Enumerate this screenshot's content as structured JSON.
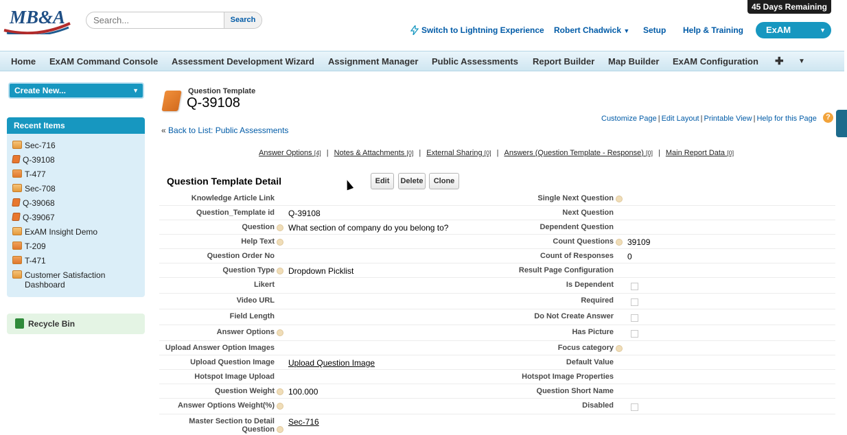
{
  "header": {
    "logo_text": "MB&A",
    "search_placeholder": "Search...",
    "search_button": "Search",
    "days_remaining": "45 Days Remaining",
    "switch_lightning": "Switch to Lightning Experience",
    "user_name": "Robert Chadwick",
    "setup": "Setup",
    "help_training": "Help & Training",
    "app_name": "ExAM"
  },
  "tabs": [
    "Home",
    "ExAM Command Console",
    "Assessment Development Wizard",
    "Assignment Manager",
    "Public Assessments",
    "Report Builder",
    "Map Builder",
    "ExAM Configuration"
  ],
  "sidebar": {
    "create_new": "Create New...",
    "recent_header": "Recent Items",
    "recent_items": [
      {
        "label": "Sec-716",
        "icon": "section-icon"
      },
      {
        "label": "Q-39108",
        "icon": "question-icon"
      },
      {
        "label": "T-477",
        "icon": "template-icon"
      },
      {
        "label": "Sec-708",
        "icon": "section-icon"
      },
      {
        "label": "Q-39068",
        "icon": "question-icon"
      },
      {
        "label": "Q-39067",
        "icon": "question-icon"
      },
      {
        "label": "ExAM Insight Demo",
        "icon": "section-icon"
      },
      {
        "label": "T-209",
        "icon": "template-icon"
      },
      {
        "label": "T-471",
        "icon": "template-icon"
      },
      {
        "label": "Customer Satisfaction Dashboard",
        "icon": "section-icon"
      }
    ],
    "recycle_bin": "Recycle Bin"
  },
  "record": {
    "object_type": "Question Template",
    "name": "Q-39108",
    "back_link_prefix": "« ",
    "back_link": "Back to List: Public Assessments",
    "page_links": [
      "Customize Page",
      "Edit Layout",
      "Printable View",
      "Help for this Page"
    ],
    "help_icon": "?"
  },
  "related_lists": [
    {
      "label": "Answer Options",
      "count": "[4]"
    },
    {
      "label": "Notes & Attachments",
      "count": "[0]"
    },
    {
      "label": "External Sharing",
      "count": "[0]"
    },
    {
      "label": "Answers (Question Template - Response)",
      "count": "[0]"
    },
    {
      "label": "Main Report Data",
      "count": "[0]"
    }
  ],
  "detail": {
    "title": "Question Template Detail",
    "buttons": {
      "edit": "Edit",
      "delete": "Delete",
      "clone": "Clone"
    },
    "rows": [
      {
        "l1": "Knowledge Article Link",
        "v1": "",
        "l2": "Single Next Question",
        "v2": ""
      },
      {
        "l1": "Question_Template id",
        "v1": "Q-39108",
        "l2": "Next Question",
        "v2": ""
      },
      {
        "l1": "Question",
        "v1": "What section of company do you belong to?",
        "l2": "Dependent Question",
        "v2": ""
      },
      {
        "l1": "Help Text",
        "v1": "",
        "l2": "Count Questions",
        "v2": "39109"
      },
      {
        "l1": "Question Order No",
        "v1": "",
        "l2": "Count of Responses",
        "v2": "0"
      },
      {
        "l1": "Question Type",
        "v1": "Dropdown Picklist",
        "l2": "Result Page Configuration",
        "v2": ""
      },
      {
        "l1": "Likert",
        "v1": "",
        "l2": "Is Dependent",
        "v2": ""
      },
      {
        "l1": "Video URL",
        "v1": "",
        "l2": "Required",
        "v2": ""
      },
      {
        "l1": "Field Length",
        "v1": "",
        "l2": "Do Not Create Answer",
        "v2": ""
      },
      {
        "l1": "Answer Options",
        "v1": "",
        "l2": "Has Picture",
        "v2": ""
      },
      {
        "l1": "Upload Answer Option Images",
        "v1": "",
        "l2": "Focus category",
        "v2": ""
      },
      {
        "l1": "Upload Question Image",
        "v1": "Upload Question Image",
        "l2": "Default Value",
        "v2": ""
      },
      {
        "l1": "Hotspot Image Upload",
        "v1": "",
        "l2": "Hotspot Image Properties",
        "v2": ""
      },
      {
        "l1": "Question Weight",
        "v1": "100.000",
        "l2": "Question Short Name",
        "v2": ""
      },
      {
        "l1": "Answer Options Weight(%)",
        "v1": "",
        "l2": "Disabled",
        "v2": ""
      },
      {
        "l1": "Master Section to Detail Question",
        "v1": "Sec-716",
        "l2": "",
        "v2": ""
      }
    ]
  }
}
